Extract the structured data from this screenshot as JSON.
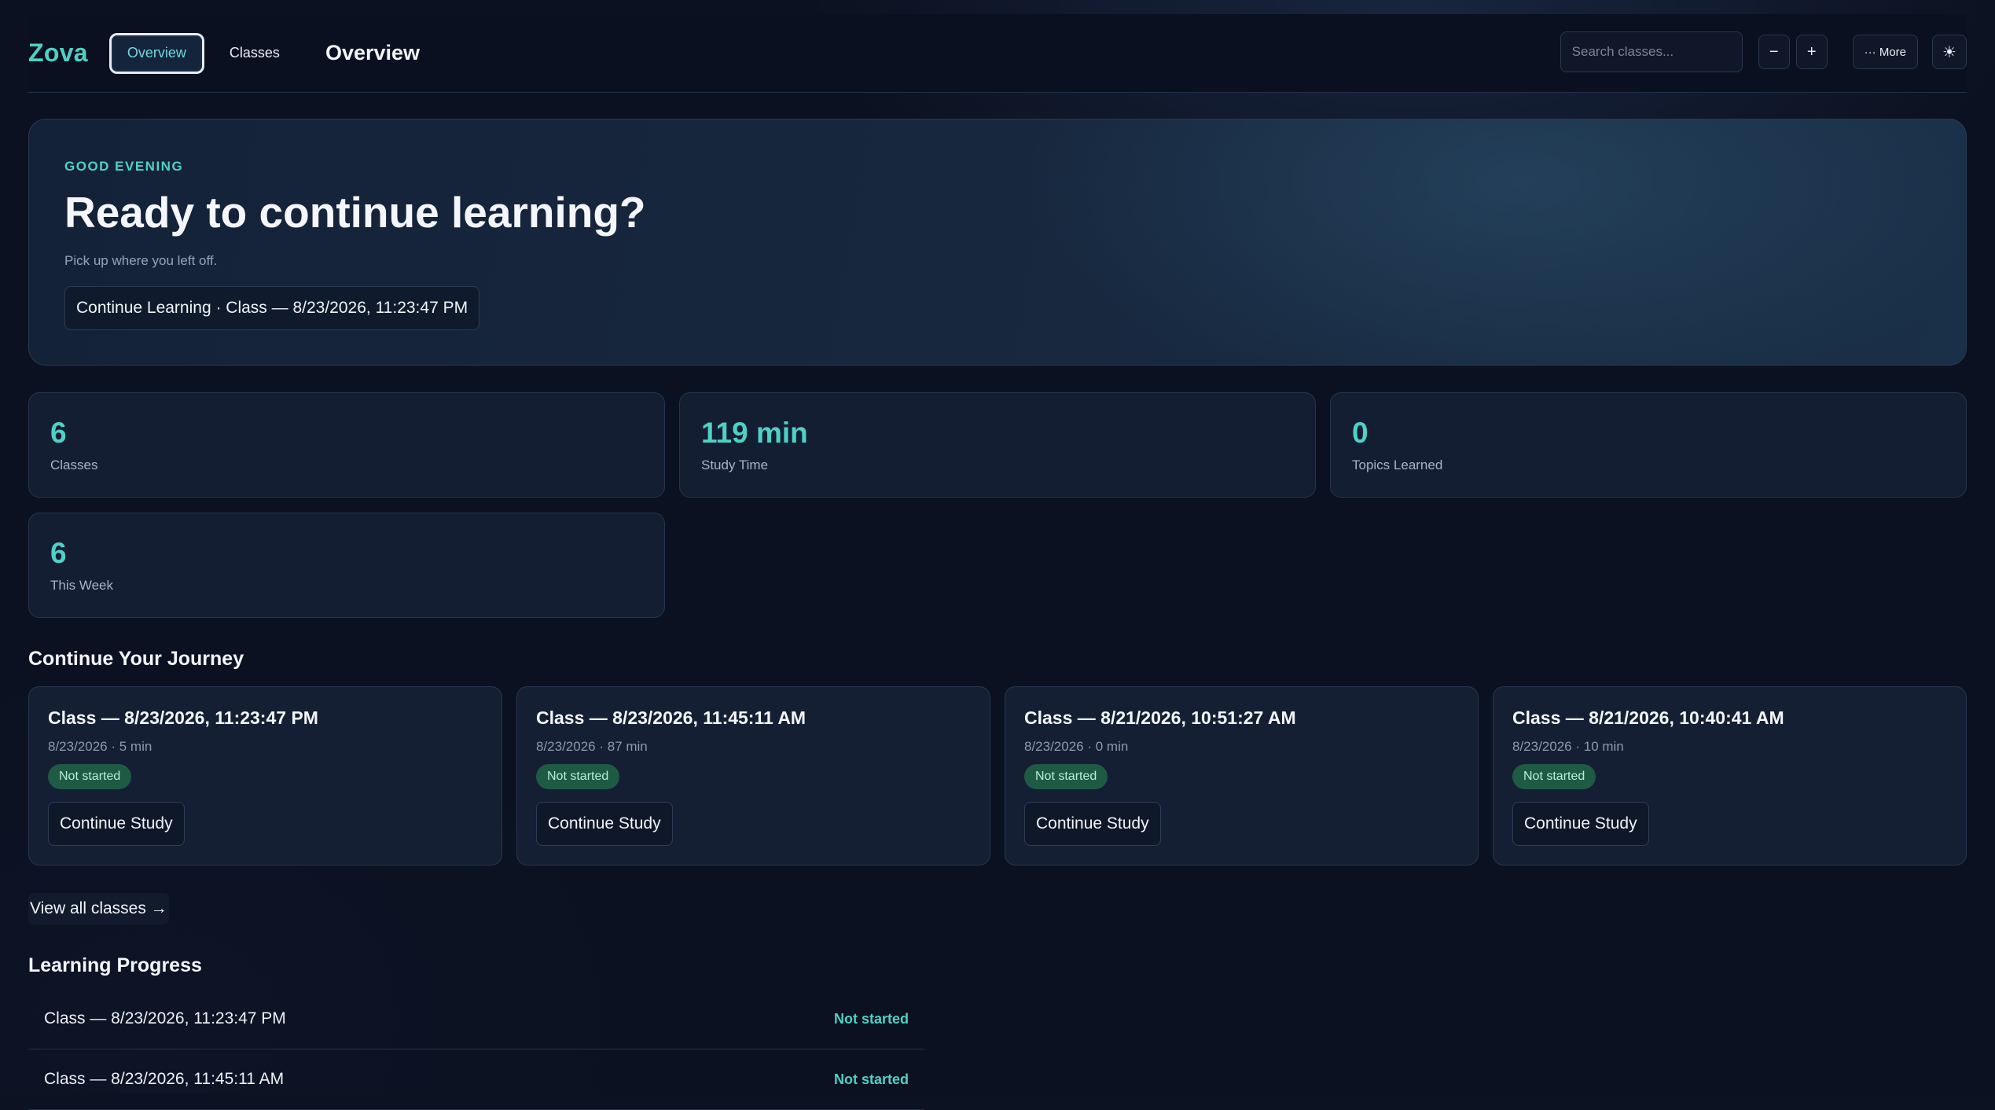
{
  "header": {
    "brand": "Zova",
    "nav": [
      {
        "label": "Overview",
        "active": true
      },
      {
        "label": "Classes",
        "active": false
      }
    ],
    "title": "Overview",
    "search_placeholder": "Search classes...",
    "zoom_out_label": "−",
    "zoom_in_label": "+",
    "more_label": "··· More",
    "theme_icon": "sun-icon",
    "theme_glyph": "☀"
  },
  "hero": {
    "greeting": "GOOD EVENING",
    "title": "Ready to continue learning?",
    "subtitle": "Pick up where you left off.",
    "button_label": "Continue Learning · Class — 8/23/2026, 11:23:47 PM"
  },
  "stats": [
    {
      "value": "6",
      "label": "Classes"
    },
    {
      "value": "119 min",
      "label": "Study Time"
    },
    {
      "value": "0",
      "label": "Topics Learned"
    },
    {
      "value": "6",
      "label": "This Week"
    }
  ],
  "journey": {
    "title": "Continue Your Journey",
    "cards": [
      {
        "title": "Class — 8/23/2026, 11:23:47 PM",
        "meta": "8/23/2026 · 5 min",
        "status": "Not started",
        "button": "Continue Study"
      },
      {
        "title": "Class — 8/23/2026, 11:45:11 AM",
        "meta": "8/23/2026 · 87 min",
        "status": "Not started",
        "button": "Continue Study"
      },
      {
        "title": "Class — 8/21/2026, 10:51:27 AM",
        "meta": "8/23/2026 · 0 min",
        "status": "Not started",
        "button": "Continue Study"
      },
      {
        "title": "Class — 8/21/2026, 10:40:41 AM",
        "meta": "8/23/2026 · 10 min",
        "status": "Not started",
        "button": "Continue Study"
      }
    ],
    "view_all": "View all classes →"
  },
  "progress": {
    "title": "Learning Progress",
    "rows": [
      {
        "name": "Class — 8/23/2026, 11:23:47 PM",
        "status": "Not started"
      },
      {
        "name": "Class — 8/23/2026, 11:45:11 AM",
        "status": "Not started"
      }
    ]
  },
  "colors": {
    "accent": "#4fd1c5",
    "background": "#0b1120",
    "card": "#151f33",
    "badge": "#1f5a45"
  }
}
